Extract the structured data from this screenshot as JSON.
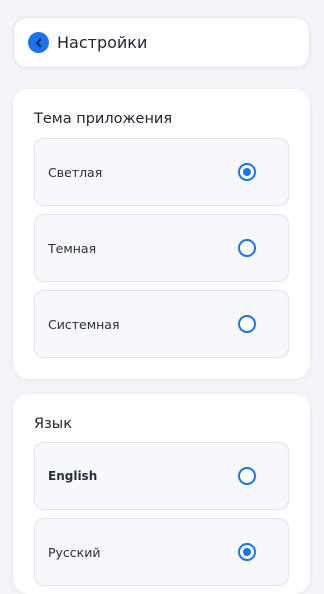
{
  "header": {
    "title": "Настройки",
    "back_icon": "chevron-left-icon"
  },
  "theme_section": {
    "title": "Тема приложения",
    "options": [
      {
        "label": "Светлая",
        "selected": true
      },
      {
        "label": "Темная",
        "selected": false
      },
      {
        "label": "Системная",
        "selected": false
      }
    ]
  },
  "language_section": {
    "title": "Язык",
    "options": [
      {
        "label": "English",
        "selected": false
      },
      {
        "label": "Русский",
        "selected": true
      }
    ]
  },
  "colors": {
    "accent": "#1a73e8",
    "background": "#f2f4f8"
  }
}
